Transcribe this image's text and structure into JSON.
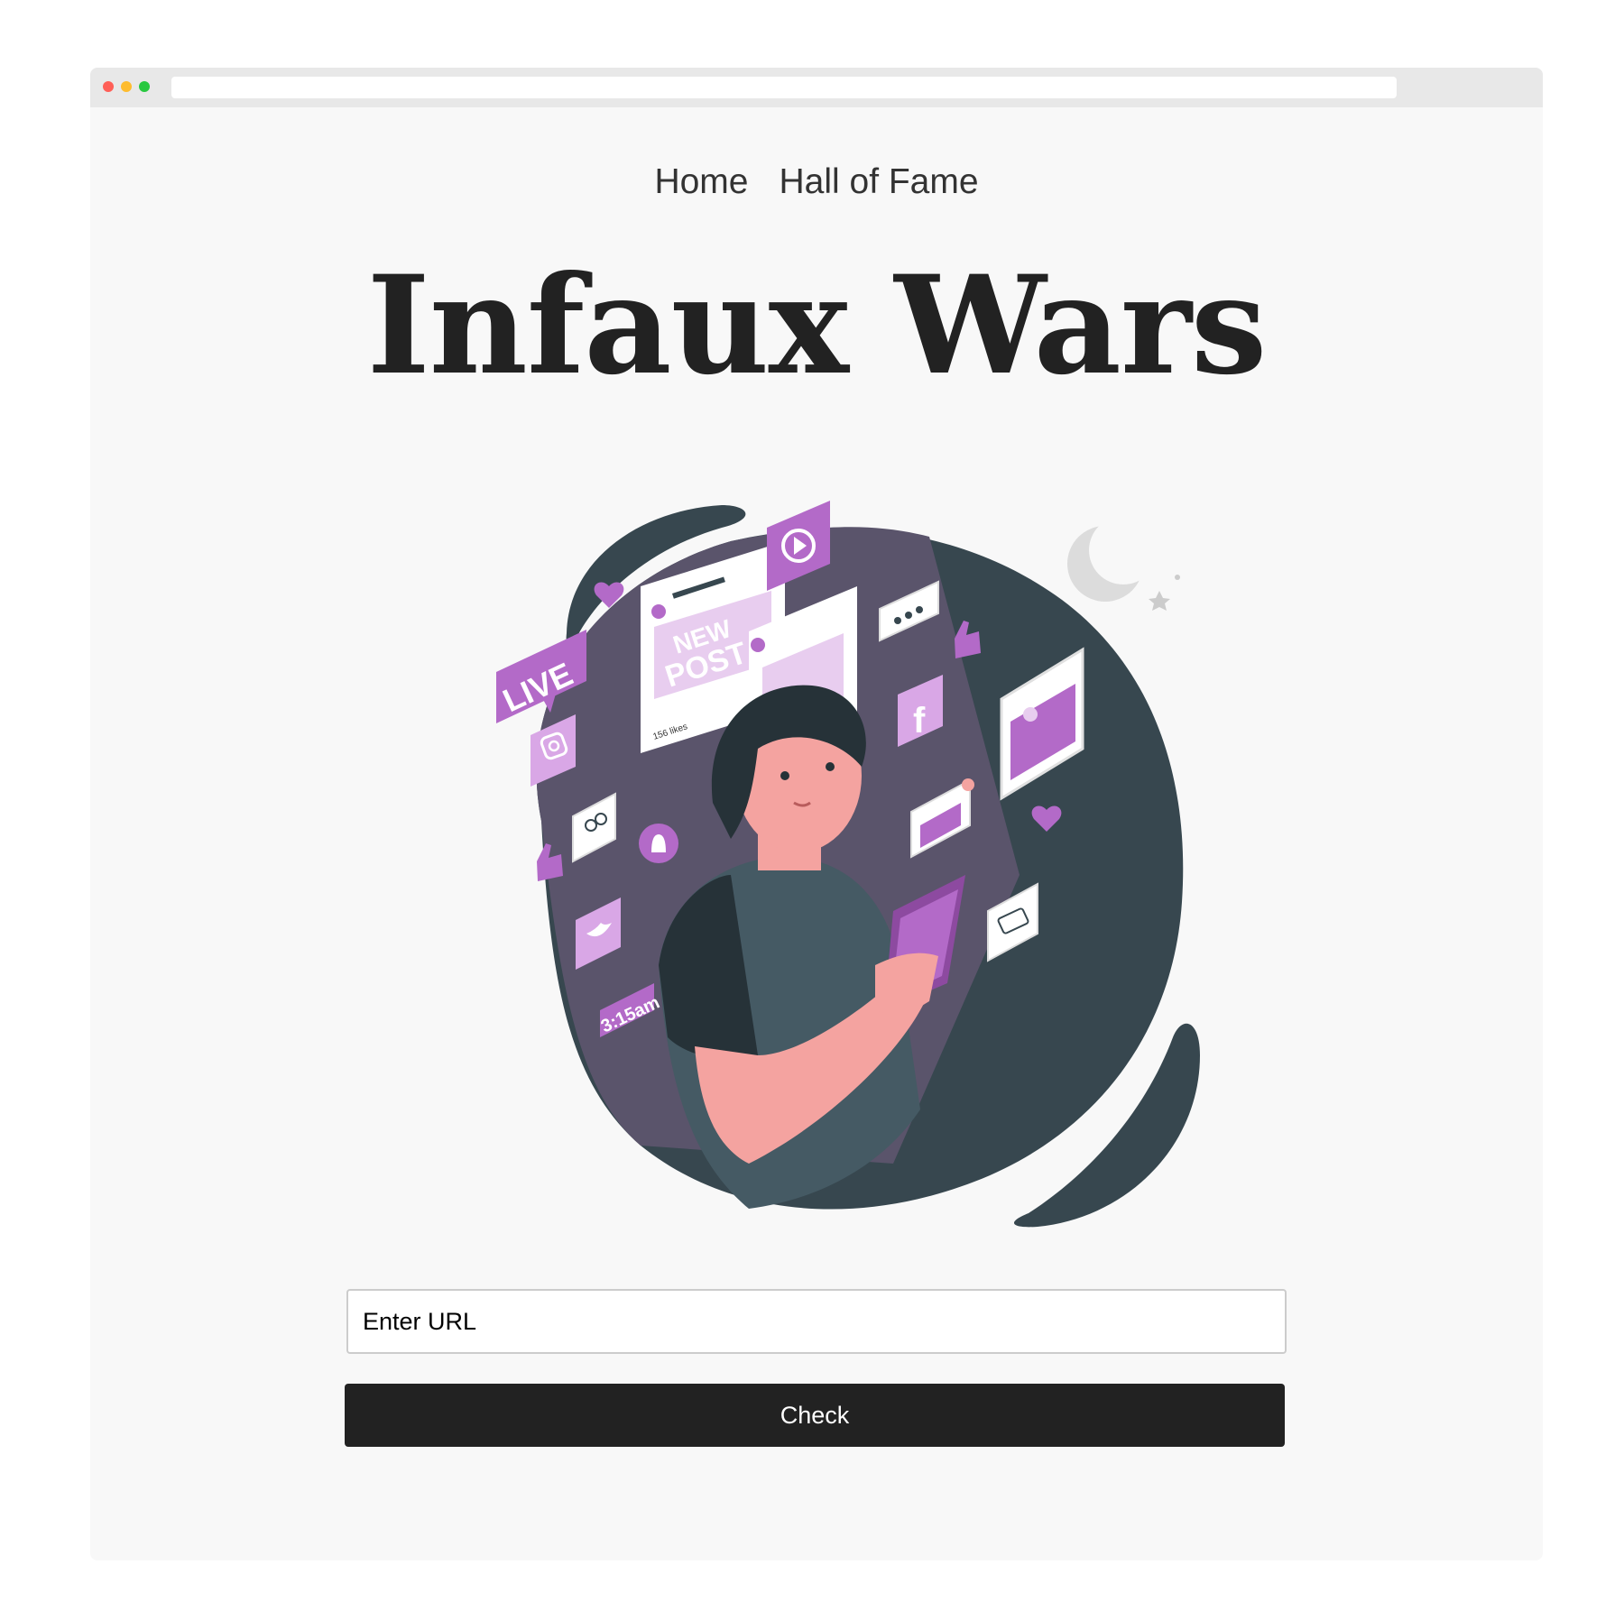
{
  "nav": {
    "items": [
      {
        "label": "Home"
      },
      {
        "label": "Hall of Fame"
      }
    ]
  },
  "header": {
    "title": "Infaux Wars"
  },
  "illustration": {
    "badges": {
      "live": "LIVE",
      "new_post_line1": "NEW",
      "new_post_line2": "POST",
      "likes": "156 likes",
      "time": "3:15am",
      "facebook": "f"
    },
    "colors": {
      "accent": "#b36ac8",
      "accent_light": "#e8cdef",
      "blob_dark": "#37474f",
      "blob_purple": "#5a546b",
      "skin": "#f4a3a0",
      "hair": "#263238",
      "shirt": "#455a64"
    }
  },
  "form": {
    "url_placeholder": "Enter URL",
    "check_label": "Check"
  }
}
